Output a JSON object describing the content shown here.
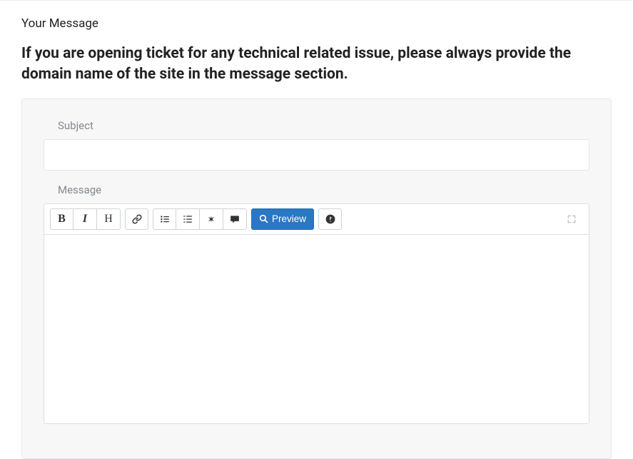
{
  "section_title": "Your Message",
  "notice": "If you are opening ticket for any technical related issue, please always provide the domain name of the site in the message section.",
  "form": {
    "subject_label": "Subject",
    "subject_value": "",
    "message_label": "Message",
    "message_value": ""
  },
  "toolbar": {
    "bold": "B",
    "italic": "I",
    "heading": "H",
    "preview_label": "Preview"
  }
}
